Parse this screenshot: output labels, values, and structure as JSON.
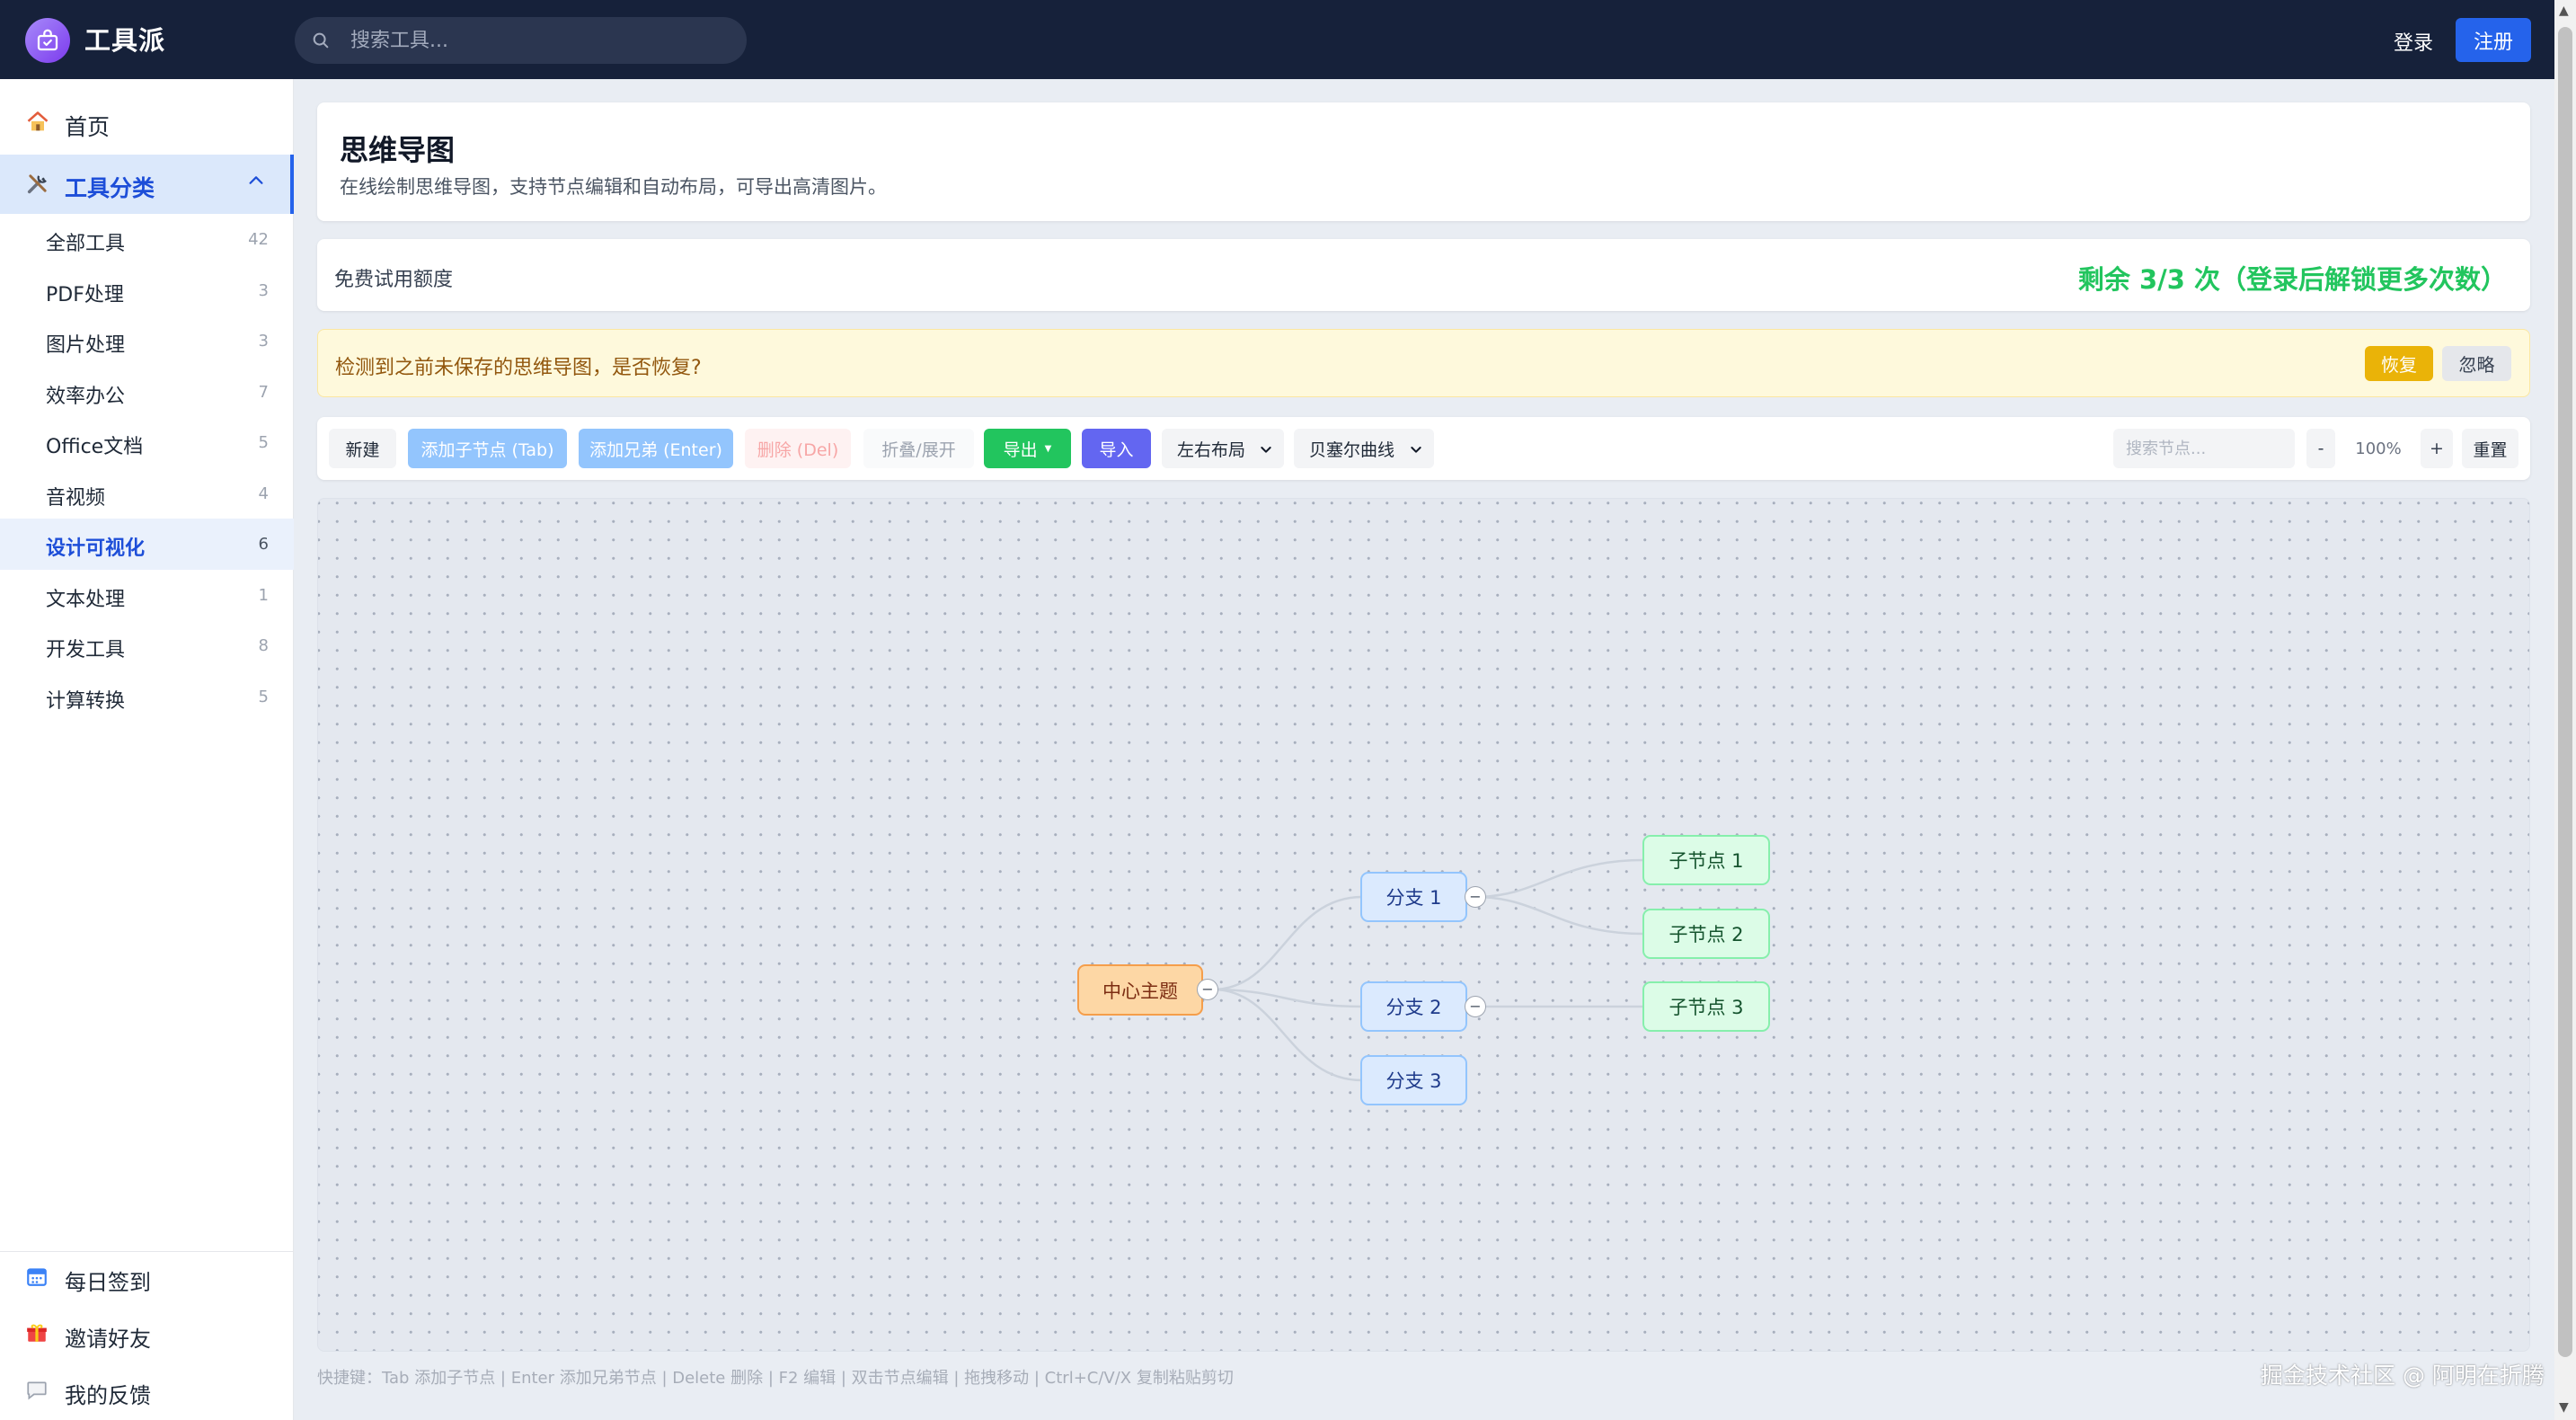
{
  "header": {
    "logo_text": "工具派",
    "search_placeholder": "搜索工具...",
    "login": "登录",
    "register": "注册"
  },
  "sidebar": {
    "home": "首页",
    "category": "工具分类",
    "items": [
      {
        "label": "全部工具",
        "count": "42"
      },
      {
        "label": "PDF处理",
        "count": "3"
      },
      {
        "label": "图片处理",
        "count": "3"
      },
      {
        "label": "效率办公",
        "count": "7"
      },
      {
        "label": "Office文档",
        "count": "5"
      },
      {
        "label": "音视频",
        "count": "4"
      },
      {
        "label": "设计可视化",
        "count": "6"
      },
      {
        "label": "文本处理",
        "count": "1"
      },
      {
        "label": "开发工具",
        "count": "8"
      },
      {
        "label": "计算转换",
        "count": "5"
      }
    ],
    "active_index": 6,
    "bottom": [
      {
        "label": "每日签到",
        "icon": "calendar-icon"
      },
      {
        "label": "邀请好友",
        "icon": "gift-icon"
      },
      {
        "label": "我的反馈",
        "icon": "chat-bubble-icon"
      }
    ]
  },
  "page": {
    "title": "思维导图",
    "description": "在线绘制思维导图，支持节点编辑和自动布局，可导出高清图片。"
  },
  "quota": {
    "label": "免费试用额度",
    "remaining": "剩余 3/3 次（登录后解锁更多次数）"
  },
  "restore": {
    "message": "检测到之前未保存的思维导图，是否恢复?",
    "restore_btn": "恢复",
    "ignore_btn": "忽略"
  },
  "toolbar": {
    "new": "新建",
    "add_child": "添加子节点 (Tab)",
    "add_sibling": "添加兄弟 (Enter)",
    "delete": "删除 (Del)",
    "fold": "折叠/展开",
    "export": "导出",
    "import": "导入",
    "layout": "左右布局",
    "curve": "贝塞尔曲线",
    "search_placeholder": "搜索节点...",
    "zoom_out": "-",
    "zoom": "100%",
    "zoom_in": "+",
    "reset": "重置"
  },
  "mindmap": {
    "root": "中心主题",
    "branches": [
      "分支 1",
      "分支 2",
      "分支 3"
    ],
    "leaves": [
      "子节点 1",
      "子节点 2",
      "子节点 3"
    ],
    "fold_symbol": "−"
  },
  "footer": {
    "tip": "快捷键：Tab 添加子节点 | Enter 添加兄弟节点 | Delete 删除 | F2 编辑 | 双击节点编辑 | 拖拽移动 | Ctrl+C/V/X 复制粘贴剪切",
    "watermark": "掘金技术社区 @ 阿明在折腾"
  },
  "colors": {
    "accent": "#2563eb",
    "quota_green": "#22c55e",
    "export_green": "#22c55e",
    "import_indigo": "#6366f1",
    "restore_yellow": "#eab308"
  }
}
